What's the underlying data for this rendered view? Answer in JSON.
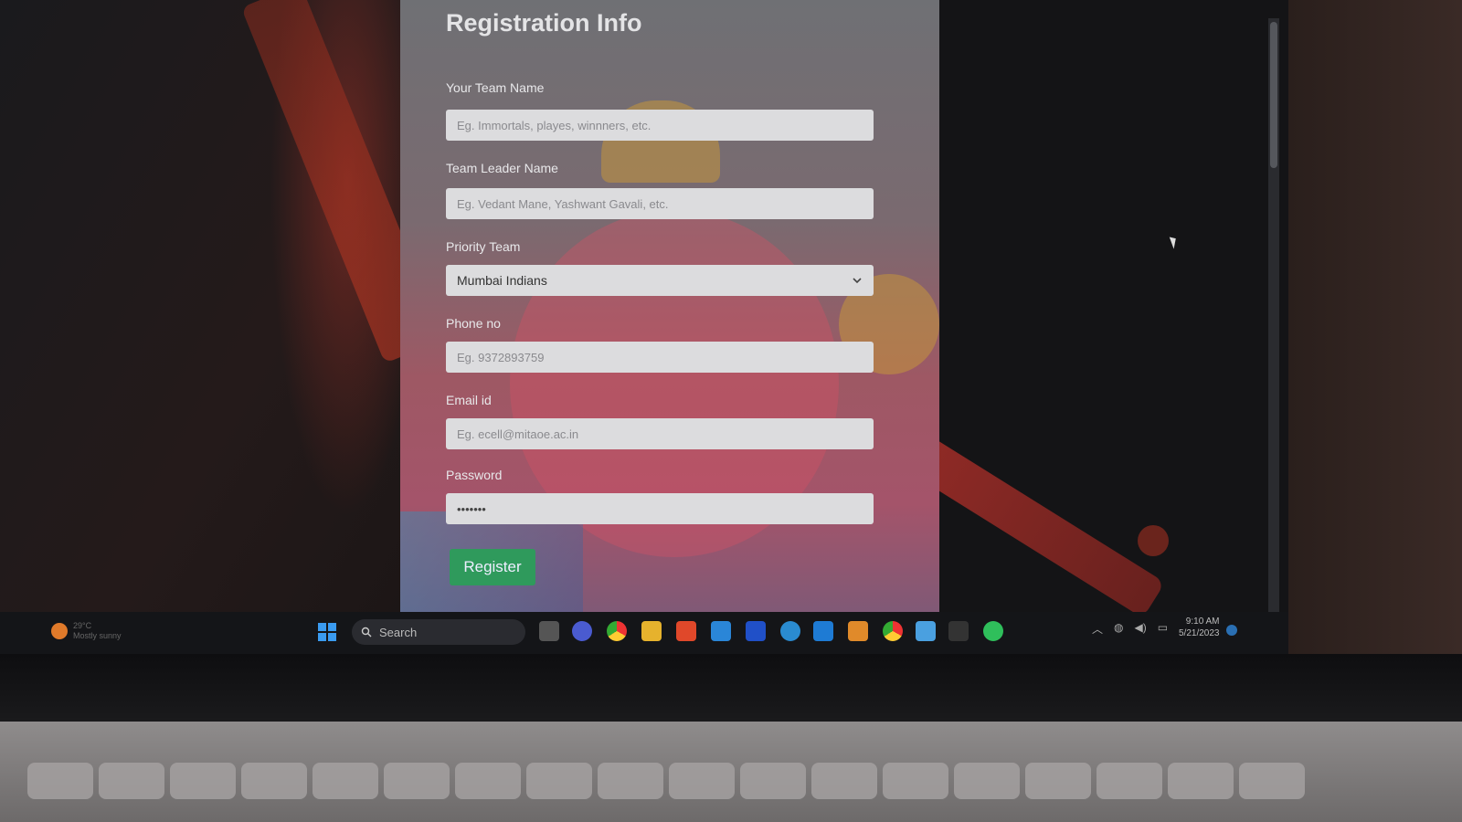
{
  "form": {
    "title": "Registration Info",
    "team_name": {
      "label": "Your Team Name",
      "placeholder": "Eg. Immortals, playes, winnners, etc."
    },
    "leader_name": {
      "label": "Team Leader Name",
      "placeholder": "Eg. Vedant Mane, Yashwant Gavali, etc."
    },
    "priority_team": {
      "label": "Priority Team",
      "selected": "Mumbai Indians"
    },
    "phone": {
      "label": "Phone no",
      "placeholder": "Eg. 9372893759"
    },
    "email": {
      "label": "Email id",
      "placeholder": "Eg. ecell@mitaoe.ac.in"
    },
    "password": {
      "label": "Password",
      "value": "•••••••"
    },
    "register_label": "Register"
  },
  "taskbar": {
    "weather_temp": "29°C",
    "weather_desc": "Mostly sunny",
    "search_label": "Search",
    "time": "9:10 AM",
    "date": "5/21/2023",
    "apps": [
      "chrome-icon",
      "file-explorer-icon",
      "brave-icon",
      "mail-icon",
      "editor-icon",
      "bing-icon",
      "vscode-icon",
      "app-icon",
      "chrome-icon",
      "notepad-icon",
      "terminal-icon",
      "whatsapp-icon"
    ]
  },
  "colors": {
    "register_button": "#2f9a5c",
    "input_bg": "#dcdcde",
    "windows_blue": "#3a9bf0"
  }
}
